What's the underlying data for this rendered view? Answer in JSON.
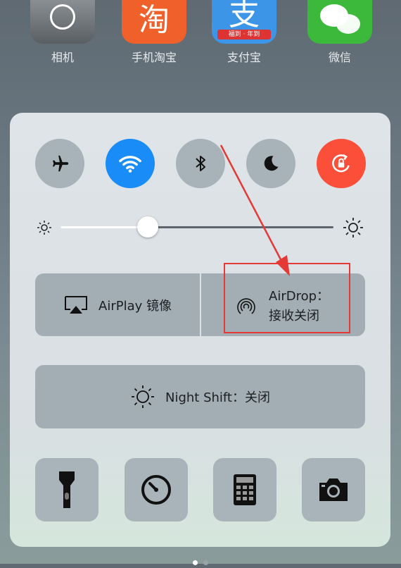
{
  "home_apps": [
    {
      "name": "相机",
      "icon": "camera-app-icon"
    },
    {
      "name": "手机淘宝",
      "icon": "taobao-app-icon",
      "glyph": "淘"
    },
    {
      "name": "支付宝",
      "icon": "alipay-app-icon",
      "glyph": "支",
      "band": "福到 · 年到"
    },
    {
      "name": "微信",
      "icon": "wechat-app-icon"
    }
  ],
  "control_center": {
    "toggles": [
      {
        "name": "airplane-mode",
        "icon": "airplane-icon",
        "state": "off"
      },
      {
        "name": "wifi",
        "icon": "wifi-icon",
        "state": "on",
        "color": "#1a8cf8"
      },
      {
        "name": "bluetooth",
        "icon": "bluetooth-icon",
        "state": "off"
      },
      {
        "name": "do-not-disturb",
        "icon": "moon-icon",
        "state": "off"
      },
      {
        "name": "rotation-lock",
        "icon": "rotation-lock-icon",
        "state": "on",
        "color": "#fb4f3a"
      }
    ],
    "brightness": {
      "level": 0.32
    },
    "airplay_label": "AirPlay 镜像",
    "airdrop_line1": "AirDrop：",
    "airdrop_line2": "接收关闭",
    "nightshift_label": "Night Shift：关闭",
    "shortcuts": [
      {
        "name": "flashlight",
        "icon": "flashlight-icon"
      },
      {
        "name": "timer",
        "icon": "timer-icon"
      },
      {
        "name": "calculator",
        "icon": "calculator-icon"
      },
      {
        "name": "camera",
        "icon": "camera-icon"
      }
    ]
  },
  "annotation": {
    "color": "#e53935"
  },
  "page_indicator": {
    "pages": 2,
    "current": 1
  }
}
